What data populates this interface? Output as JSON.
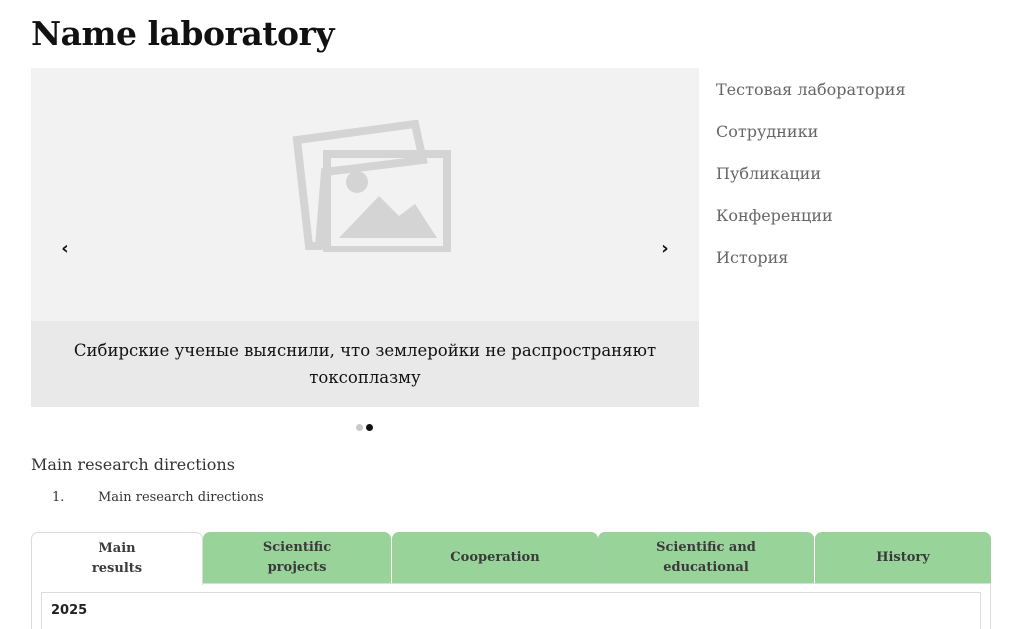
{
  "page": {
    "title": "Name laboratory"
  },
  "carousel": {
    "caption": "Сибирские ученые выяснили, что землеройки не распространяют токсоплазму",
    "prev_label": "‹",
    "next_label": "›",
    "image_icon": "image-placeholder-icon",
    "slide_count": 2,
    "active_slide": 2
  },
  "side_nav": {
    "items": [
      {
        "label": "Тестовая лаборатория"
      },
      {
        "label": "Сотрудники"
      },
      {
        "label": "Публикации"
      },
      {
        "label": "Конференции"
      },
      {
        "label": "История"
      }
    ]
  },
  "research": {
    "heading": "Main research directions",
    "list": [
      {
        "number": "1.",
        "text": "Main research directions"
      }
    ]
  },
  "tabs": {
    "items": [
      {
        "label": "Main\nresults",
        "active": true
      },
      {
        "label": "Scientific\nprojects",
        "active": false
      },
      {
        "label": "Cooperation",
        "active": false
      },
      {
        "label": "Scientific and\neducational",
        "active": false
      },
      {
        "label": "History",
        "active": false
      }
    ],
    "content": {
      "year": "2025"
    }
  },
  "colors": {
    "tab_green": "#98d49a",
    "carousel_bg": "#f2f2f2",
    "caption_bg": "#e9e9e9",
    "nav_text": "#666666"
  }
}
